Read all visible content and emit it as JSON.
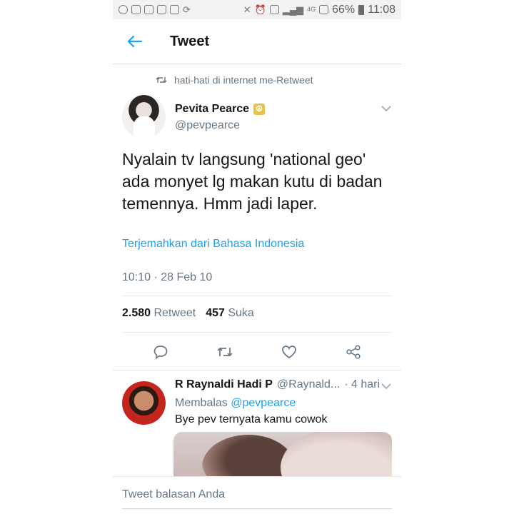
{
  "status_bar": {
    "battery_percent": "66%",
    "time": "11:08",
    "network": "4G"
  },
  "header": {
    "title": "Tweet"
  },
  "retweet_context": "hati-hati di internet me-Retweet",
  "tweet": {
    "author_name": "Pevita Pearce",
    "author_handle": "@pevpearce",
    "text": "Nyalain tv langsung 'national geo' ada monyet lg makan kutu di badan temennya. Hmm jadi laper.",
    "translate_label": "Terjemahkan dari Bahasa Indonesia",
    "timestamp": "10:10 · 28 Feb 10",
    "retweets_count": "2.580",
    "retweets_label": "Retweet",
    "likes_count": "457",
    "likes_label": "Suka"
  },
  "reply": {
    "author_name": "R Raynaldi Hadi P",
    "author_handle": "@Raynald...",
    "time": "· 4 hari",
    "replying_label": "Membalas",
    "replying_to": "@pevpearce",
    "text": "Bye pev ternyata kamu cowok"
  },
  "compose": {
    "placeholder": "Tweet balasan Anda"
  },
  "colors": {
    "accent": "#1da1f2",
    "secondary_text": "#657786",
    "badge": "#e8c24a"
  }
}
